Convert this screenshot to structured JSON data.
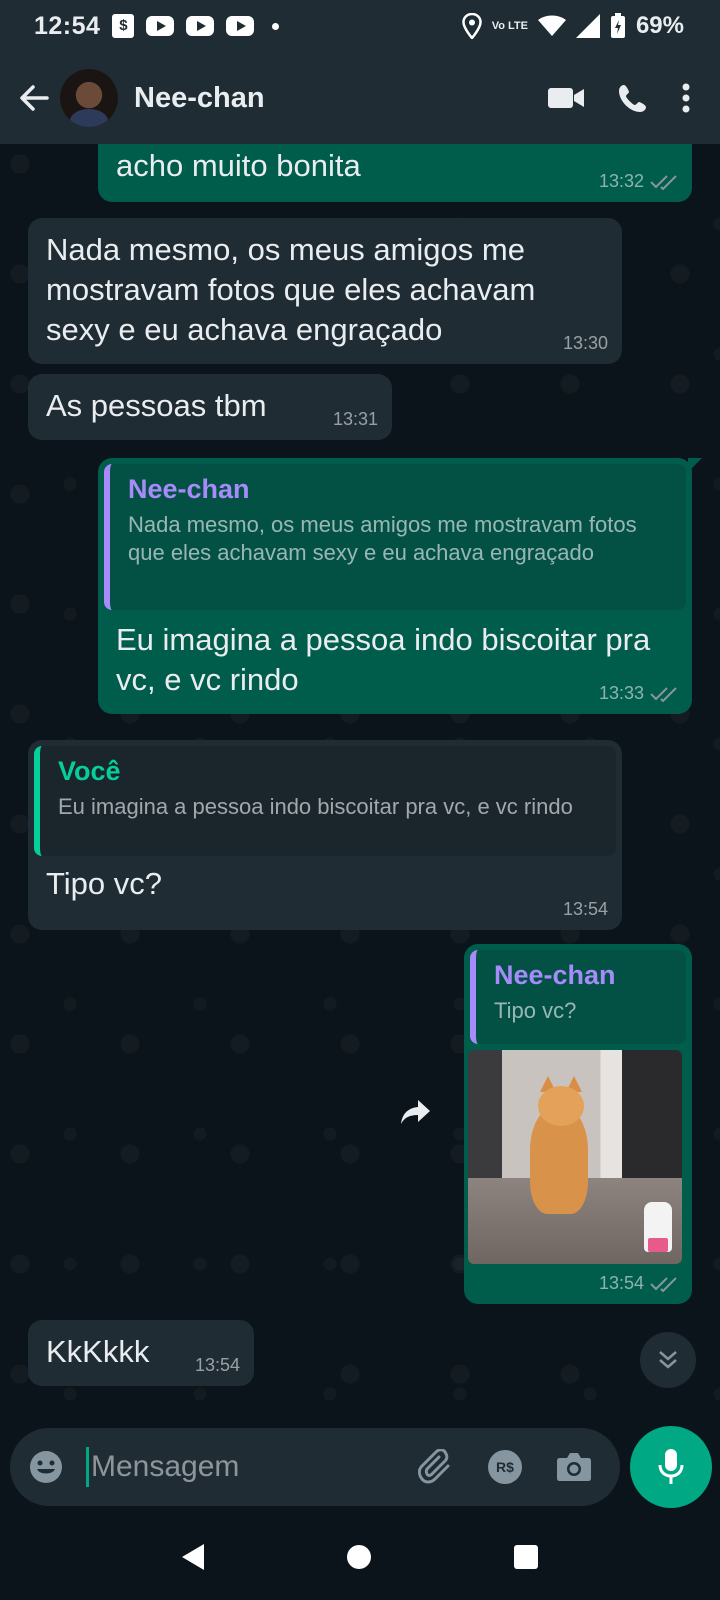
{
  "status_bar": {
    "time": "12:54",
    "network": "Vo LTE",
    "battery": "69%"
  },
  "header": {
    "contact_name": "Nee-chan"
  },
  "messages": [
    {
      "dir": "out",
      "text": "acho muito bonita",
      "time": "13:32"
    },
    {
      "dir": "in",
      "text": "Nada mesmo, os meus amigos me mostravam fotos que eles achavam sexy e eu achava engraçado",
      "time": "13:30"
    },
    {
      "dir": "in",
      "text": "As pessoas tbm",
      "time": "13:31"
    },
    {
      "dir": "out",
      "quote_name": "Nee-chan",
      "quote_text": "Nada mesmo, os meus amigos me mostravam fotos que eles achavam sexy e eu achava engraçado",
      "text": "Eu imagina a pessoa indo biscoitar pra vc, e vc rindo",
      "time": "13:33"
    },
    {
      "dir": "in",
      "quote_name": "Você",
      "quote_text": "Eu imagina a pessoa indo biscoitar pra vc, e vc rindo",
      "text": "Tipo vc?",
      "time": "13:54"
    },
    {
      "dir": "out",
      "quote_name": "Nee-chan",
      "quote_text": "Tipo vc?",
      "media": "cat-photo",
      "time": "13:54"
    },
    {
      "dir": "in",
      "text": "KkKkkk",
      "time": "13:54"
    }
  ],
  "composer": {
    "placeholder": "Mensagem",
    "currency_label": "R$"
  },
  "colors": {
    "outgoing": "#005c4b",
    "incoming": "#1f2c34",
    "accent": "#00a884",
    "quote_name_out": "#a78bfa",
    "quote_name_in": "#06cf9c"
  }
}
